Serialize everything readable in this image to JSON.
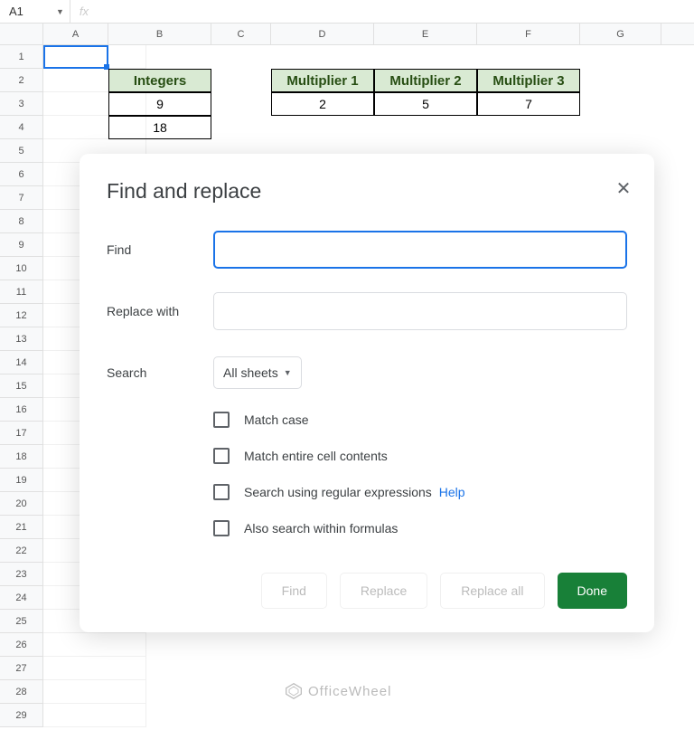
{
  "formula_bar": {
    "cell_ref": "A1",
    "fx": "fx",
    "value": ""
  },
  "columns": [
    "A",
    "B",
    "C",
    "D",
    "E",
    "F",
    "G"
  ],
  "rows": [
    "1",
    "2",
    "3",
    "4",
    "5",
    "6",
    "7",
    "8",
    "9",
    "10",
    "11",
    "12",
    "13",
    "14",
    "15",
    "16",
    "17",
    "18",
    "19",
    "20",
    "21",
    "22",
    "23",
    "24",
    "25",
    "26",
    "27",
    "28",
    "29"
  ],
  "tables": {
    "integers": {
      "header": "Integers",
      "values": [
        "9",
        "18"
      ]
    },
    "multipliers": {
      "headers": [
        "Multiplier 1",
        "Multiplier 2",
        "Multiplier 3"
      ],
      "values": [
        "2",
        "5",
        "7"
      ]
    }
  },
  "dialog": {
    "title": "Find and replace",
    "find_label": "Find",
    "find_value": "",
    "replace_label": "Replace with",
    "replace_value": "",
    "search_label": "Search",
    "search_scope": "All sheets",
    "opt_match_case": "Match case",
    "opt_match_entire": "Match entire cell contents",
    "opt_regex": "Search using regular expressions",
    "opt_formulas": "Also search within formulas",
    "help": "Help",
    "btn_find": "Find",
    "btn_replace": "Replace",
    "btn_replace_all": "Replace all",
    "btn_done": "Done"
  },
  "watermark": "OfficeWheel"
}
